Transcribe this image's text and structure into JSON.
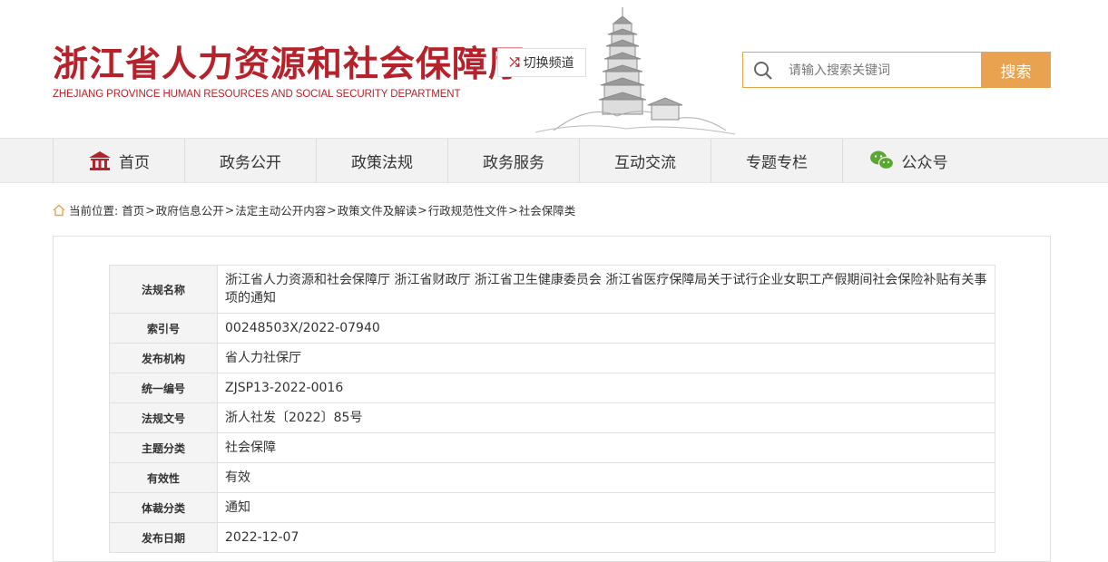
{
  "header": {
    "title_cn": "浙江省人力资源和社会保障厅",
    "title_en": "ZHEJIANG PROVINCE HUMAN RESOURCES AND SOCIAL SECURITY DEPARTMENT",
    "switch_label": "切换频道",
    "search_placeholder": "请输入搜索关键词",
    "search_button": "搜索",
    "accent_color": "#b6222b",
    "search_color": "#e9a24f"
  },
  "nav": {
    "items": [
      {
        "label": "首页",
        "icon": "home-icon"
      },
      {
        "label": "政务公开"
      },
      {
        "label": "政策法规"
      },
      {
        "label": "政务服务"
      },
      {
        "label": "互动交流"
      },
      {
        "label": "专题专栏"
      },
      {
        "label": "公众号",
        "icon": "wechat-icon"
      }
    ]
  },
  "breadcrumb": {
    "prefix": "当前位置:",
    "items": [
      "首页",
      "政府信息公开",
      "法定主动公开内容",
      "政策文件及解读",
      "行政规范性文件",
      "社会保障类"
    ],
    "separator": ">"
  },
  "document_meta": {
    "rows": [
      {
        "label": "法规名称",
        "value": "浙江省人力资源和社会保障厅 浙江省财政厅 浙江省卫生健康委员会 浙江省医疗保障局关于试行企业女职工产假期间社会保险补贴有关事项的通知"
      },
      {
        "label": "索引号",
        "value": "00248503X/2022-07940"
      },
      {
        "label": "发布机构",
        "value": "省人力社保厅"
      },
      {
        "label": "统一编号",
        "value": "ZJSP13-2022-0016"
      },
      {
        "label": "法规文号",
        "value": "浙人社发〔2022〕85号"
      },
      {
        "label": "主题分类",
        "value": "社会保障"
      },
      {
        "label": "有效性",
        "value": "有效"
      },
      {
        "label": "体裁分类",
        "value": "通知"
      },
      {
        "label": "发布日期",
        "value": "2022-12-07"
      }
    ]
  }
}
